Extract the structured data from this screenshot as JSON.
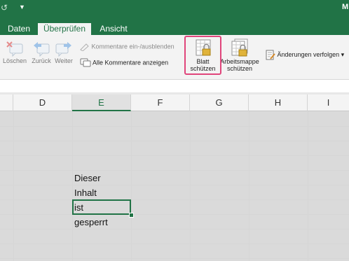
{
  "quick_access": {
    "undo_icon": "redo-arrow-icon",
    "more_icon": "dropdown-icon",
    "right_letter": "M"
  },
  "tabs": [
    {
      "label": "Daten"
    },
    {
      "label": "Überprüfen"
    },
    {
      "label": "Ansicht"
    }
  ],
  "ribbon": {
    "delete_label": "Löschen",
    "back_label": "Zurück",
    "next_label": "Weiter",
    "toggle_comments_label": "Kommentare ein-/ausblenden",
    "show_all_comments_label": "Alle Kommentare anzeigen",
    "protect_sheet_line1": "Blatt",
    "protect_sheet_line2": "schützen",
    "protect_workbook_line1": "Arbeitsmappe",
    "protect_workbook_line2": "schützen",
    "track_changes_label": "Änderungen verfolgen",
    "track_changes_arrow": "▾"
  },
  "columns": [
    "D",
    "E",
    "F",
    "G",
    "H",
    "I"
  ],
  "cells": [
    "Dieser",
    "Inhalt",
    "ist",
    "gesperrt"
  ],
  "colors": {
    "accent": "#217346",
    "highlight": "#e0457b"
  }
}
